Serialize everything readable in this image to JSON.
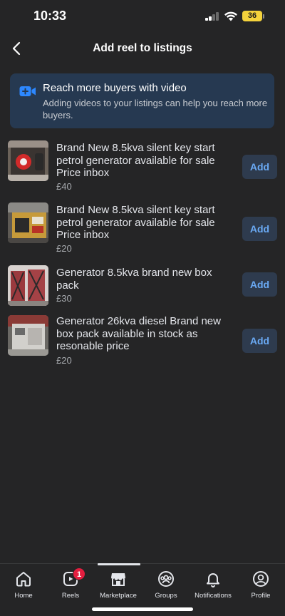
{
  "status_bar": {
    "time": "10:33",
    "battery": "36",
    "battery_color": "#f5d33c"
  },
  "header": {
    "title": "Add reel to listings",
    "back_icon": "chevron-left-icon"
  },
  "banner": {
    "icon": "video-add-icon",
    "title": "Reach more buyers with video",
    "body": "Adding videos to your listings can help you reach more buyers.",
    "background": "#263951",
    "icon_color": "#2d88ff"
  },
  "listings": [
    {
      "title": "Brand New 8.5kva silent key start petrol generator available for sale Price inbox",
      "price": "£40",
      "add_label": "Add"
    },
    {
      "title": "Brand New 8.5kva silent key start petrol generator available for sale Price inbox",
      "price": "£20",
      "add_label": "Add"
    },
    {
      "title": "Generator 8.5kva brand new box pack",
      "price": "£30",
      "add_label": "Add"
    },
    {
      "title": "Generator 26kva diesel Brand new box pack available in stock as resonable price",
      "price": "£20",
      "add_label": "Add"
    }
  ],
  "bottom_nav": {
    "items": [
      {
        "label": "Home",
        "icon": "home-icon"
      },
      {
        "label": "Reels",
        "icon": "reels-icon",
        "badge": "1"
      },
      {
        "label": "Marketplace",
        "icon": "marketplace-icon",
        "active": true
      },
      {
        "label": "Groups",
        "icon": "groups-icon"
      },
      {
        "label": "Notifications",
        "icon": "bell-icon"
      },
      {
        "label": "Profile",
        "icon": "profile-icon"
      }
    ],
    "badge_color": "#e41e3f"
  },
  "colors": {
    "background": "#252526",
    "add_button_bg": "#2e3b4e",
    "add_button_text": "#6aaaf5"
  }
}
